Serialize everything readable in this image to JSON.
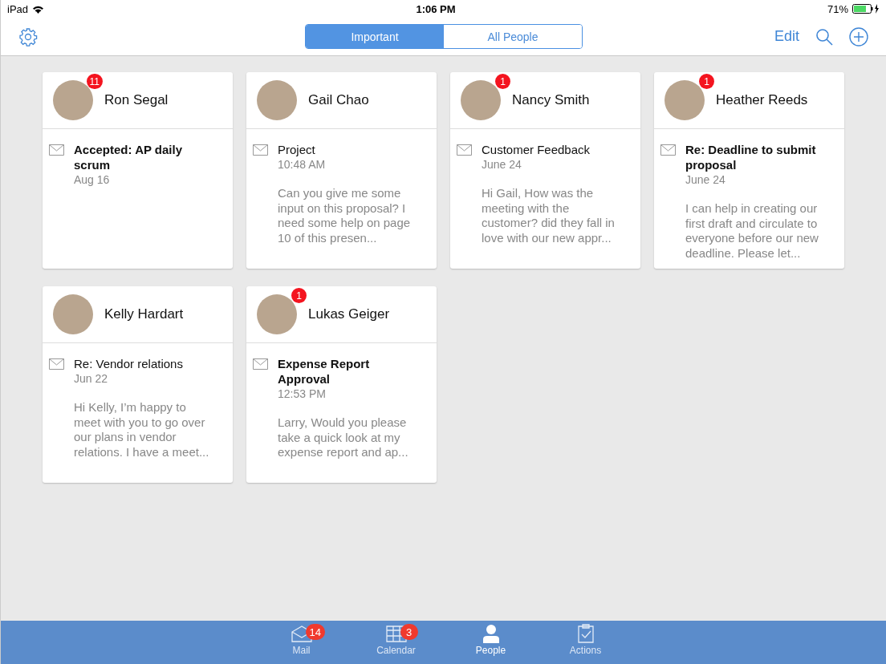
{
  "status_bar": {
    "device": "iPad",
    "time": "1:06 PM",
    "battery": "71%"
  },
  "nav": {
    "segments": [
      {
        "label": "Important",
        "selected": true
      },
      {
        "label": "All People",
        "selected": false
      }
    ],
    "edit": "Edit"
  },
  "cards": [
    {
      "name": "Ron Segal",
      "badge": "11",
      "subject": "Accepted: AP daily scrum",
      "unread": true,
      "date": "Aug 16"
    },
    {
      "name": "Gail Chao",
      "subject": "Project",
      "unread": false,
      "date": "10:48 AM",
      "preview": "Can you give me some input on this proposal? I need some help on page 10 of this presen..."
    },
    {
      "name": "Nancy Smith",
      "badge": "1",
      "subject": "Customer Feedback",
      "unread": false,
      "date": "June 24",
      "preview": "Hi Gail, How was the meeting with the customer? did they fall in love with our new appr..."
    },
    {
      "name": "Heather Reeds",
      "badge": "1",
      "subject": "Re: Deadline to submit proposal",
      "unread": true,
      "date": "June 24",
      "preview": "I can help in creating our first draft and circulate to everyone before our new deadline. Please let..."
    },
    {
      "name": "Kelly Hardart",
      "subject": "Re: Vendor relations",
      "unread": false,
      "date": "Jun 22",
      "preview": "Hi Kelly, I’m happy to meet with you to go over our plans in vendor relations. I have a meet..."
    },
    {
      "name": "Lukas Geiger",
      "badge": "1",
      "subject": "Expense Report Approval",
      "unread": true,
      "date": "12:53 PM",
      "preview": "Larry, Would you please take a quick look at my expense report and ap..."
    }
  ],
  "tab_bar": [
    {
      "kind": "mail",
      "label": "Mail",
      "badge": "14",
      "selected": false
    },
    {
      "kind": "calendar",
      "label": "Calendar",
      "badge": "3",
      "selected": false
    },
    {
      "kind": "people",
      "label": "People",
      "selected": true
    },
    {
      "kind": "actions",
      "label": "Actions",
      "selected": false
    }
  ]
}
